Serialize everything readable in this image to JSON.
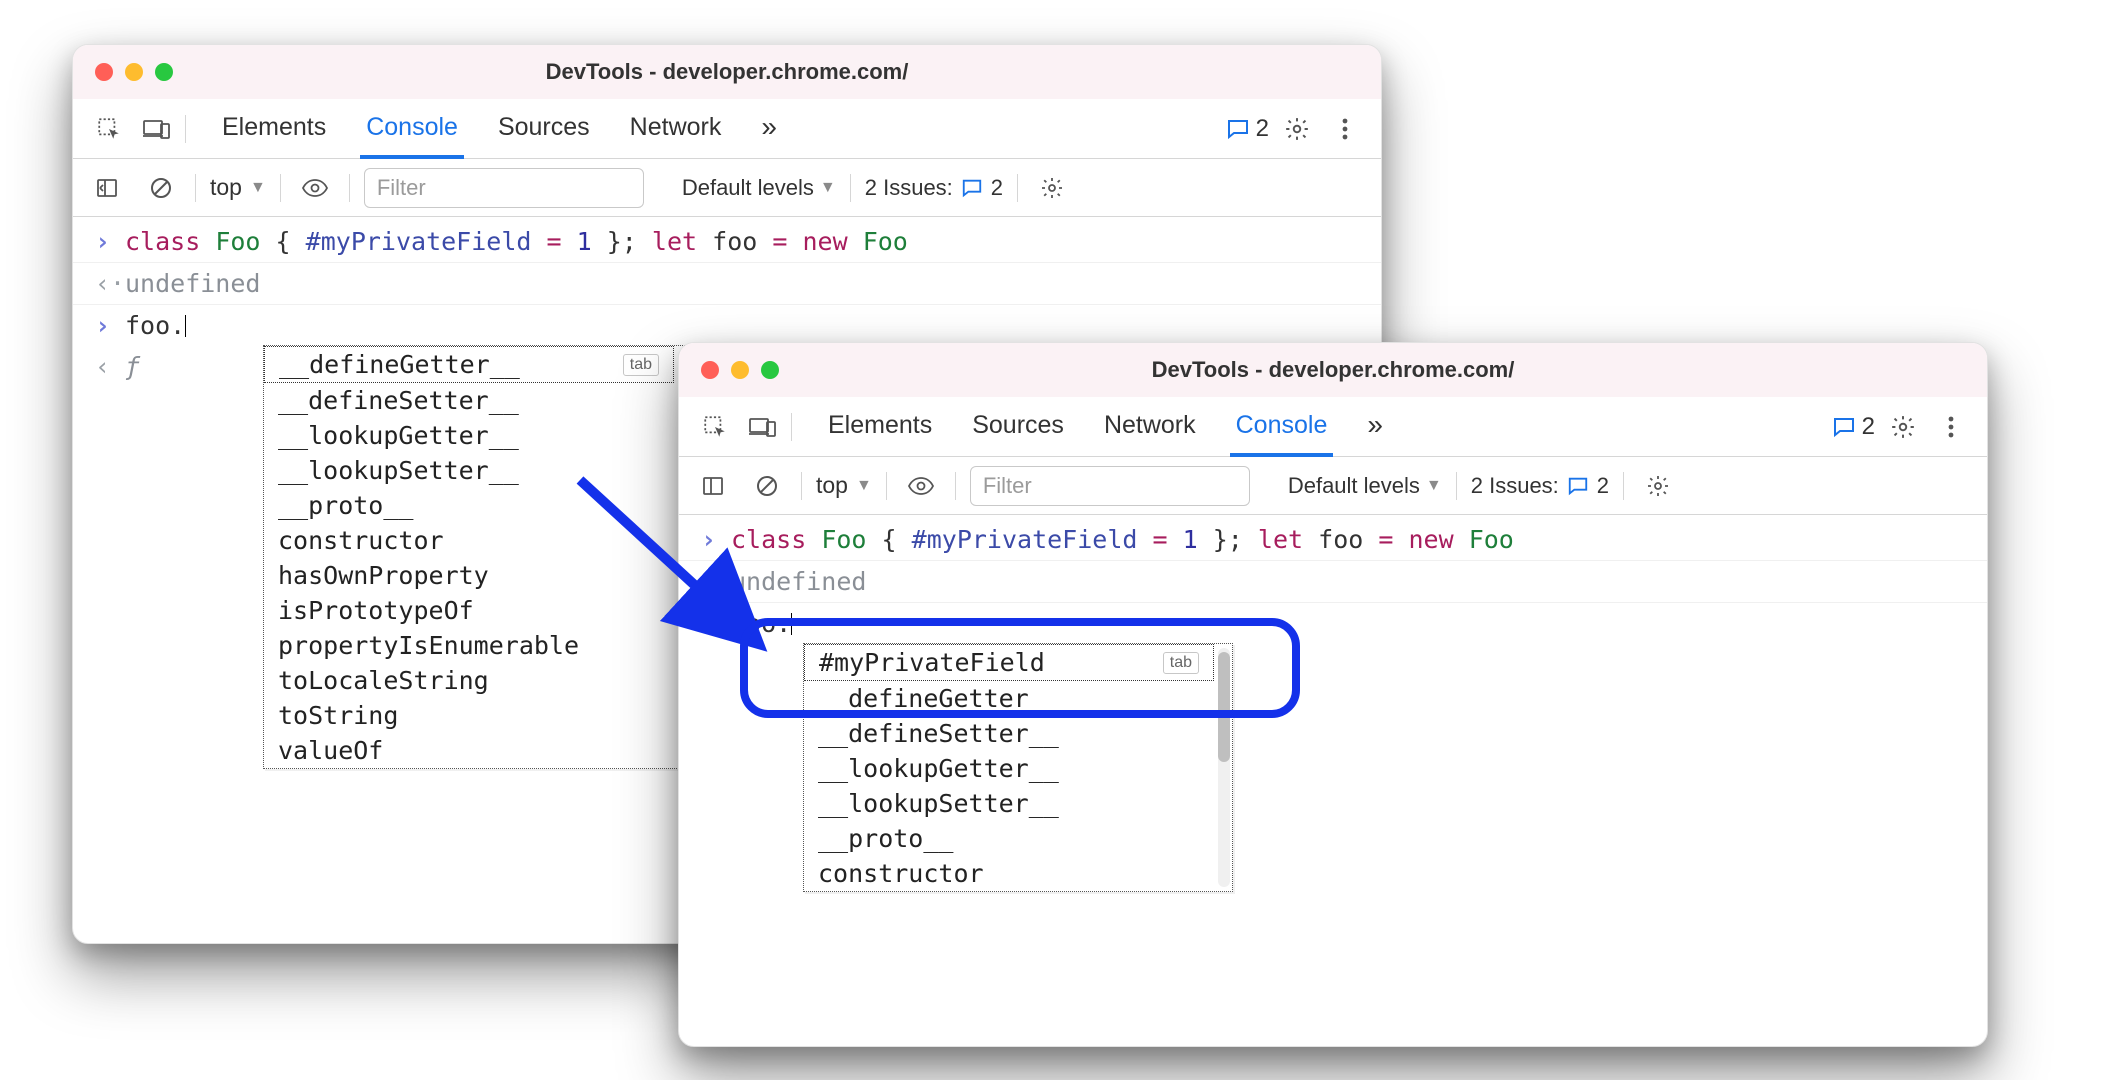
{
  "windows": {
    "w1": {
      "title": "DevTools - developer.chrome.com/",
      "tabs": [
        "Elements",
        "Console",
        "Sources",
        "Network"
      ],
      "active_tab": "Console",
      "overflow_glyph": "»",
      "feedback_count": "2",
      "console_toolbar": {
        "context_label": "top",
        "filter_placeholder": "Filter",
        "levels_label": "Default levels",
        "issues_label": "2 Issues:",
        "issues_count": "2"
      },
      "lines": {
        "input1_tokens": {
          "class": "class",
          "Foo": "Foo",
          "open": "{",
          "priv": "#myPrivateField",
          "eq": " = ",
          "one": "1",
          "close": "};",
          "let": "let",
          "foo": "foo",
          "assign": " = ",
          "new": "new",
          "Foo2": "Foo"
        },
        "undefined": "undefined",
        "input2": "foo.",
        "result_glyph": "ƒ"
      },
      "autocomplete": {
        "tab_hint": "tab",
        "options": [
          "__defineGetter__",
          "__defineSetter__",
          "__lookupGetter__",
          "__lookupSetter__",
          "__proto__",
          "constructor",
          "hasOwnProperty",
          "isPrototypeOf",
          "propertyIsEnumerable",
          "toLocaleString",
          "toString",
          "valueOf"
        ]
      }
    },
    "w2": {
      "title": "DevTools - developer.chrome.com/",
      "tabs": [
        "Elements",
        "Sources",
        "Network",
        "Console"
      ],
      "active_tab": "Console",
      "overflow_glyph": "»",
      "feedback_count": "2",
      "console_toolbar": {
        "context_label": "top",
        "filter_placeholder": "Filter",
        "levels_label": "Default levels",
        "issues_label": "2 Issues:",
        "issues_count": "2"
      },
      "lines": {
        "input1_tokens": {
          "class": "class",
          "Foo": "Foo",
          "open": "{",
          "priv": "#myPrivateField",
          "eq": " = ",
          "one": "1",
          "close": "};",
          "let": "let",
          "foo": "foo",
          "assign": " = ",
          "new": "new",
          "Foo2": "Foo"
        },
        "undefined": "undefined",
        "input2": "foo."
      },
      "autocomplete": {
        "tab_hint": "tab",
        "options": [
          "#myPrivateField",
          "__defineGetter__",
          "__defineSetter__",
          "__lookupGetter__",
          "__lookupSetter__",
          "__proto__",
          "constructor"
        ]
      }
    }
  }
}
